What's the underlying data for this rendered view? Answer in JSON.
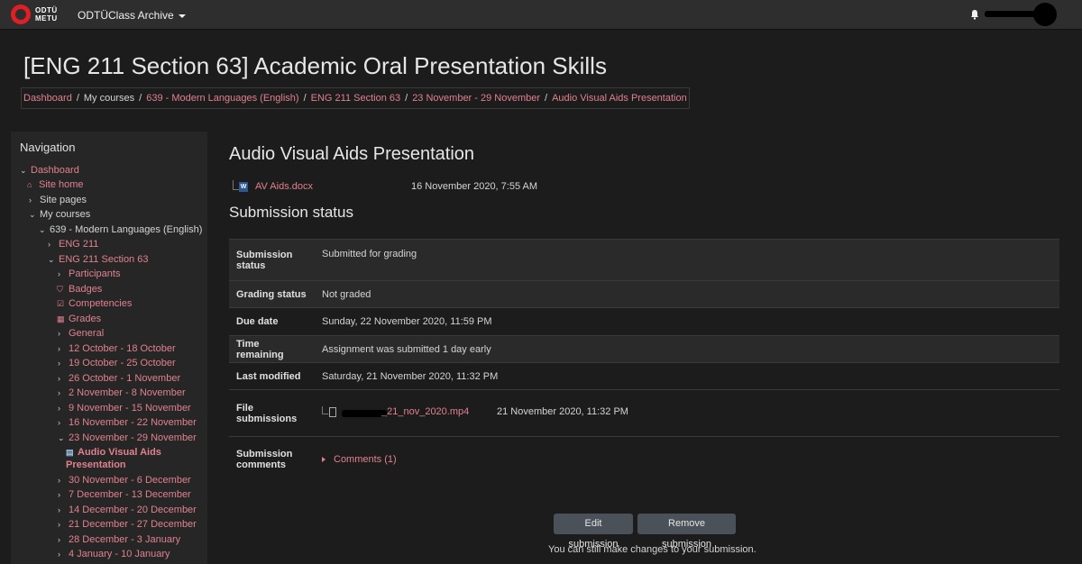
{
  "header": {
    "logo_line1": "ODTÜ",
    "logo_line2": "METU",
    "site_menu": "ODTÜClass Archive"
  },
  "page": {
    "title": "[ENG 211 Section 63] Academic Oral Presentation Skills"
  },
  "breadcrumb": [
    "Dashboard",
    "My courses",
    "639 - Modern Languages (English)",
    "ENG 211 Section 63",
    "23 November - 29 November",
    "Audio Visual Aids Presentation"
  ],
  "navigation": {
    "title": "Navigation",
    "items": [
      {
        "label": "Dashboard",
        "icon": "chevron-down"
      },
      {
        "label": "Site home",
        "icon": "home-icon"
      },
      {
        "label": "Site pages",
        "icon": "chevron-right"
      },
      {
        "label": "My courses",
        "icon": "chevron-down"
      },
      {
        "label": "639 - Modern Languages (English)",
        "icon": "chevron-down"
      },
      {
        "label": "ENG 211",
        "icon": "chevron-right"
      },
      {
        "label": "ENG 211 Section 63",
        "icon": "chevron-down"
      },
      {
        "label": "Participants",
        "icon": "chevron-right"
      },
      {
        "label": "Badges",
        "icon": "shield-icon"
      },
      {
        "label": "Competencies",
        "icon": "checkbox-icon"
      },
      {
        "label": "Grades",
        "icon": "table-icon"
      },
      {
        "label": "General",
        "icon": "chevron-right"
      },
      {
        "label": "12 October - 18 October",
        "icon": "chevron-right"
      },
      {
        "label": "19 October - 25 October",
        "icon": "chevron-right"
      },
      {
        "label": "26 October - 1 November",
        "icon": "chevron-right"
      },
      {
        "label": "2 November - 8 November",
        "icon": "chevron-right"
      },
      {
        "label": "9 November - 15 November",
        "icon": "chevron-right"
      },
      {
        "label": "16 November - 22 November",
        "icon": "chevron-right"
      },
      {
        "label": "23 November - 29 November",
        "icon": "chevron-down"
      },
      {
        "label": "Audio Visual Aids",
        "label2": "Presentation",
        "icon": "assignment-icon"
      },
      {
        "label": "30 November - 6 December",
        "icon": "chevron-right"
      },
      {
        "label": "7 December - 13 December",
        "icon": "chevron-right"
      },
      {
        "label": "14 December - 20 December",
        "icon": "chevron-right"
      },
      {
        "label": "21 December - 27 December",
        "icon": "chevron-right"
      },
      {
        "label": "28 December - 3 January",
        "icon": "chevron-right"
      },
      {
        "label": "4 January - 10 January",
        "icon": "chevron-right"
      }
    ]
  },
  "main": {
    "heading": "Audio Visual Aids Presentation",
    "attachment": {
      "name": "AV Aids.docx",
      "date": "16 November 2020, 7:55 AM",
      "icon": "W"
    },
    "status_heading": "Submission status",
    "rows": [
      {
        "label": "Submission status",
        "value": "Submitted for grading",
        "status_color": "#1e5f1a"
      },
      {
        "label": "Grading status",
        "value": "Not graded"
      },
      {
        "label": "Due date",
        "value": "Sunday, 22 November 2020, 11:59 PM"
      },
      {
        "label": "Time remaining",
        "value": "Assignment was submitted 1 day early",
        "status_color": "#1e5f1a"
      },
      {
        "label": "Last modified",
        "value": "Saturday, 21 November 2020, 11:32 PM"
      },
      {
        "label": "File submissions",
        "file_name": "_21_nov_2020.mp4",
        "file_date": "21 November 2020, 11:32 PM"
      },
      {
        "label": "Submission comments",
        "value": "Comments (1)"
      }
    ],
    "edit_button": "Edit submission",
    "remove_button": "Remove submission",
    "note": "You can still make changes to your submission."
  }
}
